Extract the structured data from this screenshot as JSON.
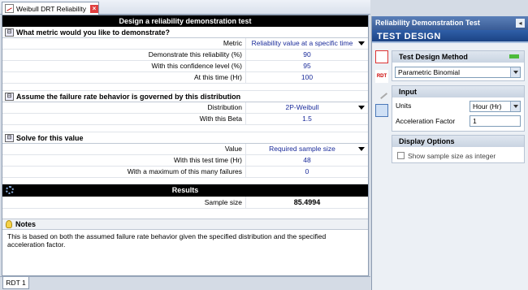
{
  "tab": {
    "title": "Weibull DRT Reliability"
  },
  "doc": {
    "header": "Design a reliability demonstration test",
    "section1": {
      "title": "What metric would you like to demonstrate?",
      "rows": [
        {
          "label": "Metric",
          "value": "Reliability value at a specific time"
        },
        {
          "label": "Demonstrate this reliability (%)",
          "value": "90"
        },
        {
          "label": "With this confidence level (%)",
          "value": "95"
        },
        {
          "label": "At this time (Hr)",
          "value": "100"
        }
      ]
    },
    "section2": {
      "title": "Assume the failure rate behavior is governed by this distribution",
      "rows": [
        {
          "label": "Distribution",
          "value": "2P-Weibull"
        },
        {
          "label": "With this Beta",
          "value": "1.5"
        }
      ]
    },
    "section3": {
      "title": "Solve for this value",
      "rows": [
        {
          "label": "Value",
          "value": "Required sample size"
        },
        {
          "label": "With this test time (Hr)",
          "value": "48"
        },
        {
          "label": "With a maximum of this many failures",
          "value": "0"
        }
      ]
    },
    "results": {
      "title": "Results",
      "label": "Sample size",
      "value": "85.4994"
    },
    "notes": {
      "title": "Notes",
      "text": "This is based on both the assumed failure rate behavior given the specified distribution and the specified acceleration factor."
    }
  },
  "sheet_tab": "RDT 1",
  "panel": {
    "title": "Reliability Demonstration Test",
    "banner": "Test Design",
    "method_group": {
      "title": "Test Design Method",
      "selected": "Parametric Binomial"
    },
    "input_group": {
      "title": "Input",
      "units_label": "Units",
      "units_value": "Hour (Hr)",
      "accel_label": "Acceleration Factor",
      "accel_value": "1"
    },
    "display_group": {
      "title": "Display Options",
      "checkbox_label": "Show sample size as integer"
    },
    "side_icons": [
      "calendar-icon",
      "rdt-icon",
      "pencil-icon",
      "check-chart-icon"
    ]
  }
}
